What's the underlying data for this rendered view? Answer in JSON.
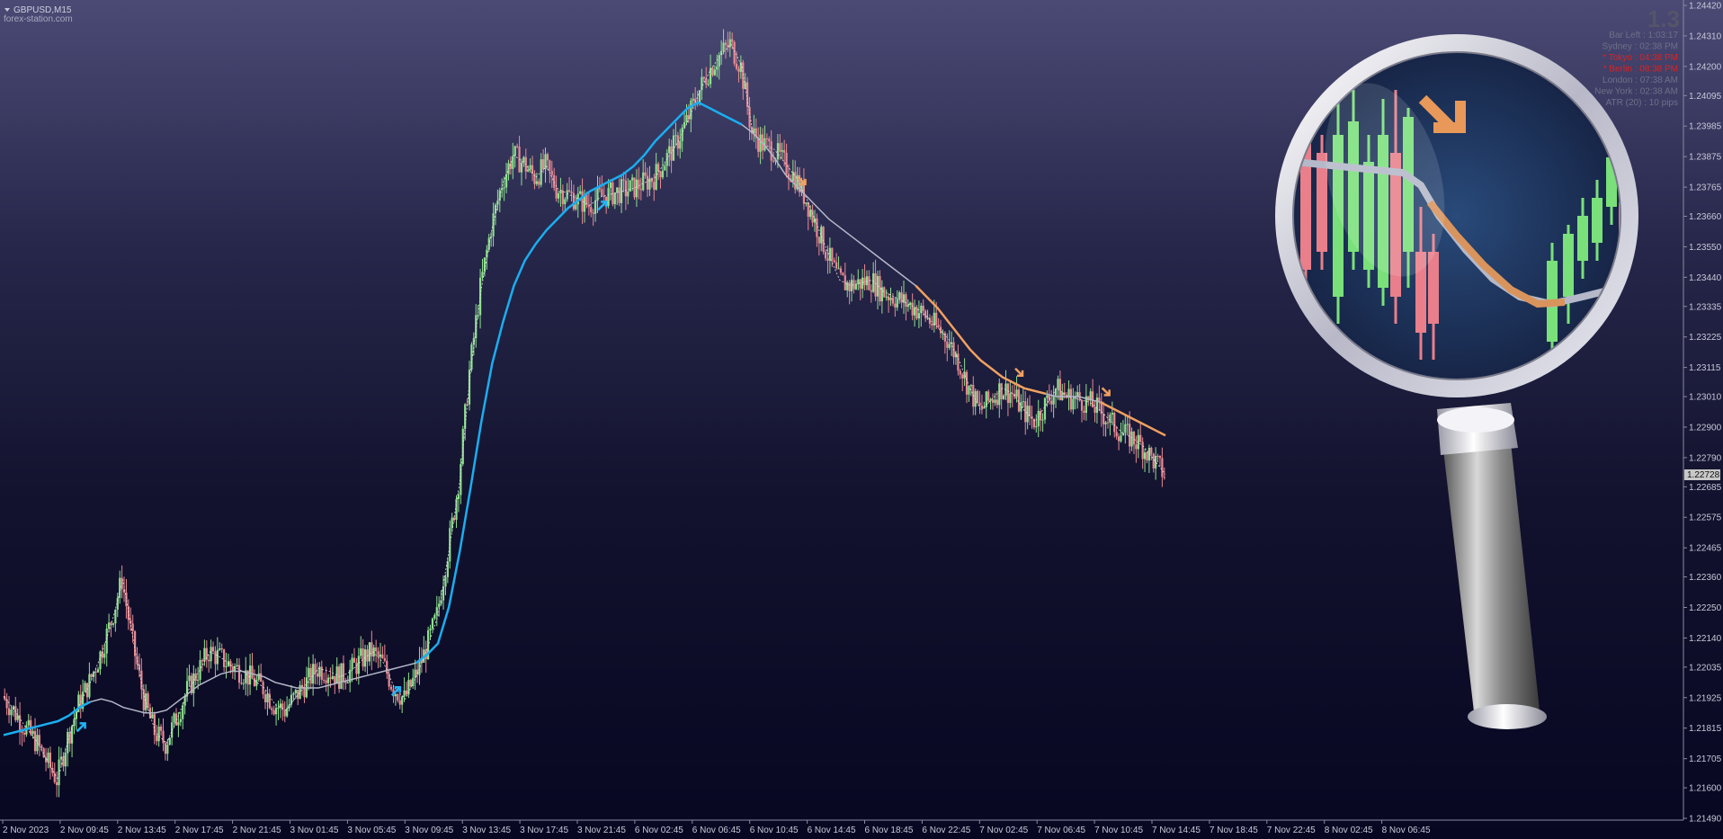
{
  "header": {
    "symbol": "GBPUSD,M15",
    "watermark": "forex-station.com"
  },
  "colors": {
    "bull": "#8ee08e",
    "bear": "#e88a92",
    "ma_up": "#1aaef0",
    "ma_flat": "#b4b8c8",
    "ma_down": "#f0a060",
    "arrow_up": "#22b4f5",
    "arrow_down": "#f0a060",
    "axis": "#9a9ab0",
    "price_tag_bg": "#c8c8c8"
  },
  "info_panel": {
    "big_value": "1.3",
    "rows": [
      {
        "text": "Bar Left :  1:03:17",
        "color": "#6e7088"
      },
      {
        "text": "Sydney  : 02:38 PM",
        "color": "#6e7088"
      },
      {
        "text": "* Tokyo : 04:38 PM",
        "color": "#e02020"
      },
      {
        "text": "* Berlin : 08:38 PM",
        "color": "#e02020"
      },
      {
        "text": "London : 07:38 AM",
        "color": "#6e7088"
      },
      {
        "text": "New York : 02:38 AM",
        "color": "#6e7088"
      },
      {
        "text": "ATR (20) : 10 pips",
        "color": "#6e7088"
      }
    ]
  },
  "current_price": "1.22728",
  "chart_data": {
    "type": "candlestick",
    "title": "GBPUSD,M15",
    "y_ticks": [
      "1.24420",
      "1.24310",
      "1.24200",
      "1.24095",
      "1.23985",
      "1.23875",
      "1.23765",
      "1.23660",
      "1.23550",
      "1.23440",
      "1.23335",
      "1.23225",
      "1.23115",
      "1.23010",
      "1.22900",
      "1.22790",
      "1.22685",
      "1.22575",
      "1.22465",
      "1.22360",
      "1.22250",
      "1.22140",
      "1.22035",
      "1.21925",
      "1.21815",
      "1.21705",
      "1.21600",
      "1.21490"
    ],
    "x_ticks": [
      "2 Nov 2023",
      "2 Nov 09:45",
      "2 Nov 13:45",
      "2 Nov 17:45",
      "2 Nov 21:45",
      "3 Nov 01:45",
      "3 Nov 05:45",
      "3 Nov 09:45",
      "3 Nov 13:45",
      "3 Nov 17:45",
      "3 Nov 21:45",
      "6 Nov 02:45",
      "6 Nov 06:45",
      "6 Nov 10:45",
      "6 Nov 14:45",
      "6 Nov 18:45",
      "6 Nov 22:45",
      "7 Nov 02:45",
      "7 Nov 06:45",
      "7 Nov 10:45",
      "7 Nov 14:45",
      "7 Nov 18:45",
      "7 Nov 22:45",
      "8 Nov 02:45",
      "8 Nov 06:45"
    ],
    "ylim": [
      1.2149,
      1.2442
    ],
    "close_path": [
      1.2193,
      1.2188,
      1.2182,
      1.2177,
      1.217,
      1.2163,
      1.2178,
      1.219,
      1.2198,
      1.2208,
      1.222,
      1.2235,
      1.2212,
      1.2192,
      1.218,
      1.2176,
      1.2185,
      1.2195,
      1.2202,
      1.2209,
      1.2207,
      1.2204,
      1.2202,
      1.2199,
      1.2196,
      1.219,
      1.2188,
      1.2193,
      1.2198,
      1.2203,
      1.2202,
      1.22,
      1.2202,
      1.2206,
      1.2209,
      1.2205,
      1.2196,
      1.2192,
      1.22,
      1.221,
      1.2222,
      1.2245,
      1.227,
      1.231,
      1.234,
      1.2362,
      1.2378,
      1.2388,
      1.2385,
      1.238,
      1.2384,
      1.2376,
      1.2374,
      1.2372,
      1.237,
      1.2373,
      1.2374,
      1.2375,
      1.2376,
      1.2378,
      1.238,
      1.2386,
      1.2392,
      1.24,
      1.241,
      1.2418,
      1.2424,
      1.2428,
      1.242,
      1.2396,
      1.2392,
      1.239,
      1.2385,
      1.238,
      1.2372,
      1.2362,
      1.2352,
      1.2343,
      1.2341,
      1.2342,
      1.2343,
      1.2339,
      1.2337,
      1.2335,
      1.2333,
      1.233,
      1.2326,
      1.2322,
      1.2314,
      1.2304,
      1.2296,
      1.23,
      1.2304,
      1.2302,
      1.2296,
      1.2292,
      1.2298,
      1.2304,
      1.2301,
      1.23,
      1.2299,
      1.2296,
      1.2292,
      1.2288,
      1.2286,
      1.2283,
      1.2278,
      1.2273
    ],
    "ma_path": [
      1.2179,
      1.218,
      1.2181,
      1.2182,
      1.2183,
      1.2184,
      1.2186,
      1.2189,
      1.2191,
      1.2192,
      1.2191,
      1.2189,
      1.2188,
      1.2187,
      1.2187,
      1.2188,
      1.2191,
      1.2194,
      1.2197,
      1.2199,
      1.2201,
      1.2202,
      1.2202,
      1.2201,
      1.22,
      1.2198,
      1.2197,
      1.2196,
      1.2196,
      1.2196,
      1.2197,
      1.2198,
      1.2199,
      1.22,
      1.2201,
      1.2202,
      1.2203,
      1.2204,
      1.2205,
      1.2208,
      1.2212,
      1.2225,
      1.2245,
      1.2268,
      1.2292,
      1.2313,
      1.2328,
      1.2341,
      1.235,
      1.2356,
      1.2361,
      1.2365,
      1.2369,
      1.2372,
      1.2375,
      1.2377,
      1.2379,
      1.2381,
      1.2384,
      1.2388,
      1.2393,
      1.2397,
      1.2401,
      1.2405,
      1.2407,
      1.2405,
      1.2403,
      1.2401,
      1.2399,
      1.2396,
      1.2392,
      1.2387,
      1.2381,
      1.2377,
      1.2373,
      1.2369,
      1.2365,
      1.2362,
      1.2359,
      1.2356,
      1.2353,
      1.235,
      1.2347,
      1.2344,
      1.2341,
      1.2337,
      1.2333,
      1.2328,
      1.2323,
      1.2318,
      1.2314,
      1.2311,
      1.2308,
      1.2306,
      1.2304,
      1.2303,
      1.2302,
      1.2301,
      1.2301,
      1.2301,
      1.23,
      1.2299,
      1.2297,
      1.2295,
      1.2293,
      1.2291,
      1.2289,
      1.2287
    ],
    "ma_color_segments": [
      {
        "from": 0,
        "to": 8,
        "color": "up"
      },
      {
        "from": 8,
        "to": 38,
        "color": "flat"
      },
      {
        "from": 38,
        "to": 68,
        "color": "up"
      },
      {
        "from": 68,
        "to": 72,
        "color": "flat"
      },
      {
        "from": 72,
        "to": 84,
        "color": "flat"
      },
      {
        "from": 84,
        "to": 96,
        "color": "down"
      },
      {
        "from": 96,
        "to": 101,
        "color": "flat"
      },
      {
        "from": 101,
        "to": 107,
        "color": "down"
      }
    ],
    "arrows": [
      {
        "i": 8,
        "dir": "up"
      },
      {
        "i": 37,
        "dir": "up"
      },
      {
        "i": 56,
        "dir": "up"
      },
      {
        "i": 74,
        "dir": "down"
      },
      {
        "i": 94,
        "dir": "down"
      },
      {
        "i": 102,
        "dir": "down"
      }
    ]
  }
}
